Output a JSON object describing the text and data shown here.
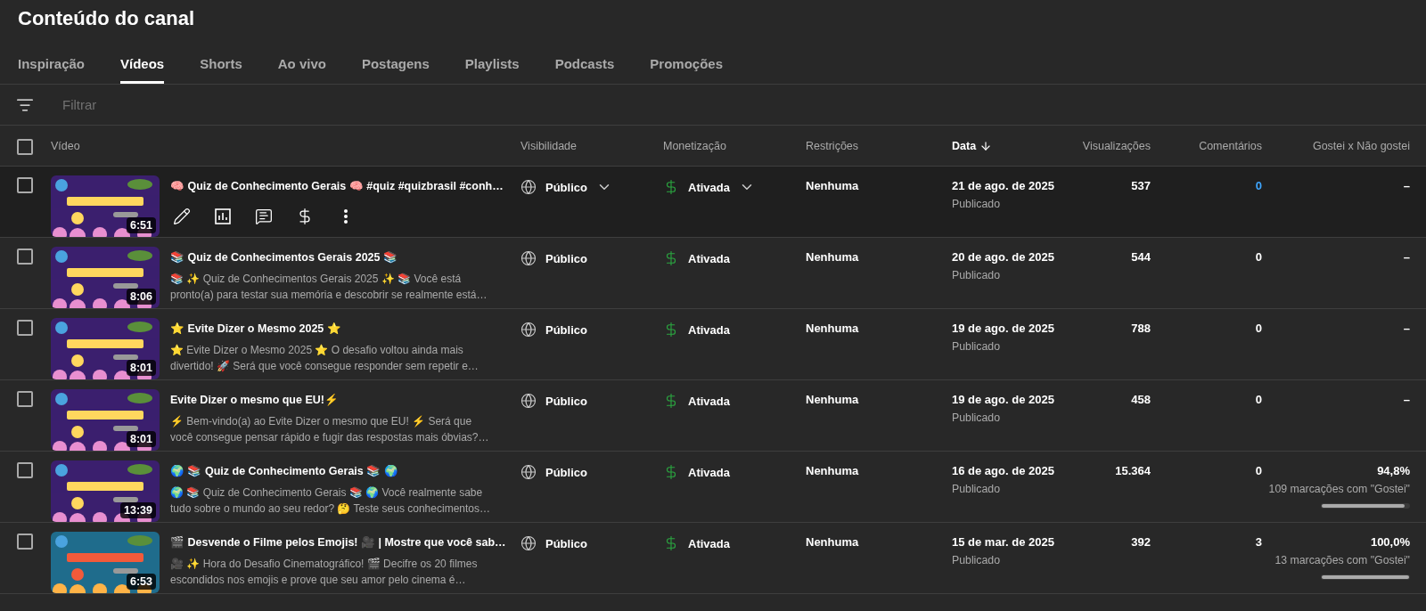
{
  "page_title": "Conteúdo do canal",
  "tabs": [
    {
      "label": "Inspiração",
      "selected": false
    },
    {
      "label": "Vídeos",
      "selected": true
    },
    {
      "label": "Shorts",
      "selected": false
    },
    {
      "label": "Ao vivo",
      "selected": false
    },
    {
      "label": "Postagens",
      "selected": false
    },
    {
      "label": "Playlists",
      "selected": false
    },
    {
      "label": "Podcasts",
      "selected": false
    },
    {
      "label": "Promoções",
      "selected": false
    }
  ],
  "filter": {
    "placeholder": "Filtrar"
  },
  "table": {
    "select_all": {
      "checked": false
    },
    "columns": [
      {
        "label": "Vídeo",
        "sorted": false
      },
      {
        "label": "Visibilidade",
        "sorted": false
      },
      {
        "label": "Monetização",
        "sorted": false
      },
      {
        "label": "Restrições",
        "sorted": false
      },
      {
        "label": "Data",
        "sorted": true
      },
      {
        "label": "Visualizações",
        "sorted": false
      },
      {
        "label": "Comentários",
        "sorted": false
      },
      {
        "label": "Gostei x Não gostei",
        "sorted": false
      }
    ],
    "rows": [
      {
        "checked": false,
        "hovered": true,
        "duration": "6:51",
        "title": "🧠 Quiz de Conhecimento Gerais 🧠 #quiz #quizbrasil #conh…",
        "visibility": "Público",
        "monetization": "Ativada",
        "restrictions": "Nenhuma",
        "date": "21 de ago. de 2025",
        "status": "Publicado",
        "views": "537",
        "comments": "0",
        "likes": {
          "percent": "–"
        }
      },
      {
        "checked": false,
        "hovered": false,
        "duration": "8:06",
        "title": "📚 Quiz de Conhecimentos Gerais 2025 📚",
        "description": "📚 ✨ Quiz de Conhecimentos Gerais 2025 ✨ 📚 Você está pronto(a) para testar sua memória e descobrir se realmente está…",
        "visibility": "Público",
        "monetization": "Ativada",
        "restrictions": "Nenhuma",
        "date": "20 de ago. de 2025",
        "status": "Publicado",
        "views": "544",
        "comments": "0",
        "likes": {
          "percent": "–"
        }
      },
      {
        "checked": false,
        "hovered": false,
        "duration": "8:01",
        "title": "⭐ Evite Dizer o Mesmo 2025 ⭐",
        "description": "⭐ Evite Dizer o Mesmo 2025 ⭐ O desafio voltou ainda mais divertido! 🚀 Será que você consegue responder sem repetir e…",
        "visibility": "Público",
        "monetization": "Ativada",
        "restrictions": "Nenhuma",
        "date": "19 de ago. de 2025",
        "status": "Publicado",
        "views": "788",
        "comments": "0",
        "likes": {
          "percent": "–"
        }
      },
      {
        "checked": false,
        "hovered": false,
        "duration": "8:01",
        "title": "Evite Dizer o mesmo que EU!⚡",
        "description": "⚡ Bem-vindo(a) ao Evite Dizer o mesmo que EU! ⚡ Será que você consegue pensar rápido e fugir das respostas mais óbvias?…",
        "visibility": "Público",
        "monetization": "Ativada",
        "restrictions": "Nenhuma",
        "date": "19 de ago. de 2025",
        "status": "Publicado",
        "views": "458",
        "comments": "0",
        "likes": {
          "percent": "–"
        }
      },
      {
        "checked": false,
        "hovered": false,
        "duration": "13:39",
        "title": "🌍 📚 Quiz de Conhecimento Gerais 📚 🌍",
        "description": "🌍 📚 Quiz de Conhecimento Gerais 📚 🌍 Você realmente sabe tudo sobre o mundo ao seu redor? 🤔 Teste seus conhecimentos…",
        "visibility": "Público",
        "monetization": "Ativada",
        "restrictions": "Nenhuma",
        "date": "16 de ago. de 2025",
        "status": "Publicado",
        "views": "15.364",
        "comments": "0",
        "likes": {
          "percent": "94,8%",
          "count": "109 marcações com \"Gostei\"",
          "level": 0.948
        }
      },
      {
        "checked": false,
        "hovered": false,
        "duration": "6:53",
        "title": "🎬 Desvende o Filme pelos Emojis! 🎥 | Mostre que você sab…",
        "description": "🎥 ✨ Hora do Desafio Cinematográfico! 🎬 Decifre os 20 filmes escondidos nos emojis e prove que seu amor pelo cinema é…",
        "visibility": "Público",
        "monetization": "Ativada",
        "restrictions": "Nenhuma",
        "date": "15 de mar. de 2025",
        "status": "Publicado",
        "views": "392",
        "comments": "3",
        "likes": {
          "percent": "100,0%",
          "count": "13 marcações com \"Gostei\"",
          "level": 1
        }
      }
    ]
  }
}
